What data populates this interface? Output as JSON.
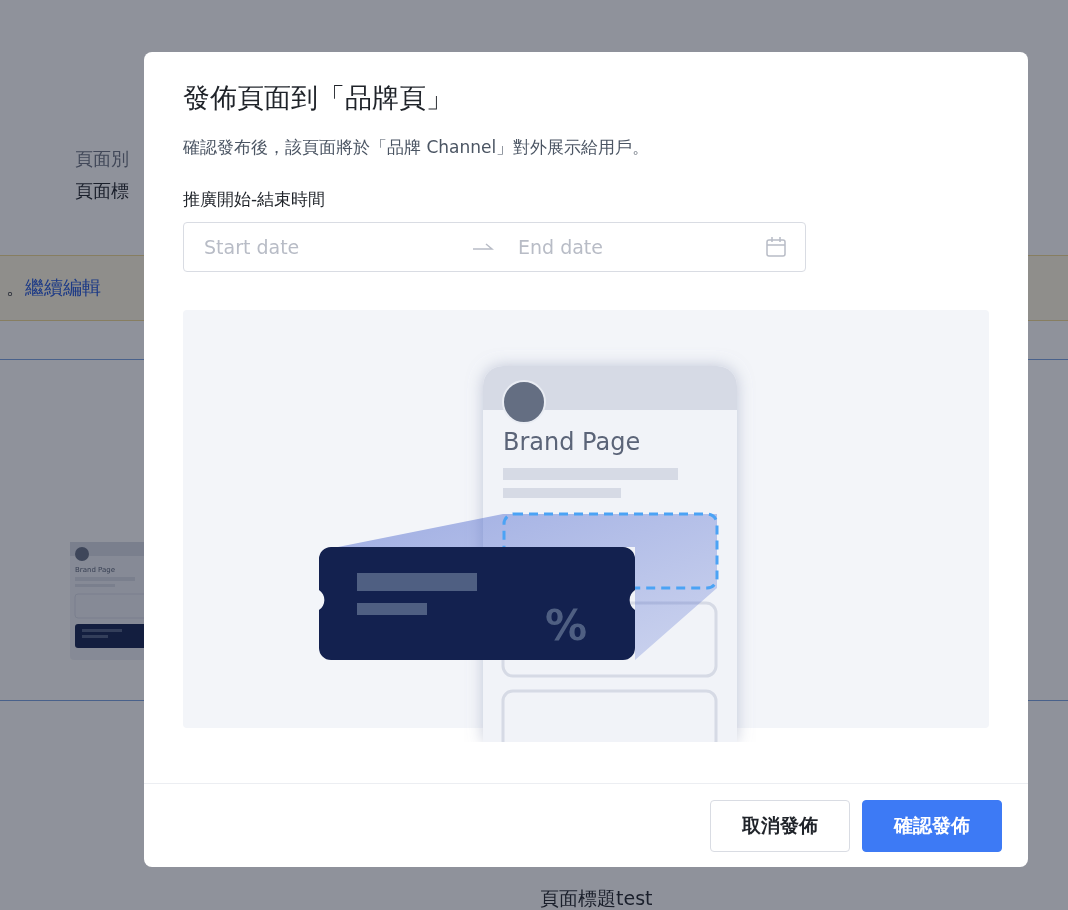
{
  "background": {
    "fields": [
      {
        "text": "頁面別",
        "kind": "muted"
      },
      {
        "text": "頁面標",
        "kind": "strong"
      }
    ],
    "notice": {
      "text": "。",
      "link": "繼續編輯"
    },
    "thumbnail": {
      "title": "Brand Page"
    },
    "footer_text": "頁面標題test"
  },
  "dialog": {
    "title": "發佈頁面到「品牌頁」",
    "description": "確認發布後，該頁面將於「品牌 Channel」對外展示給用戶。",
    "date_label": "推廣開始-結束時間",
    "date_range": {
      "start_placeholder": "Start date",
      "end_placeholder": "End date"
    },
    "illustration": {
      "title": "Brand Page",
      "symbol": "%"
    },
    "buttons": [
      {
        "label": "取消發佈",
        "kind": "secondary"
      },
      {
        "label": "確認發佈",
        "kind": "primary"
      }
    ]
  }
}
